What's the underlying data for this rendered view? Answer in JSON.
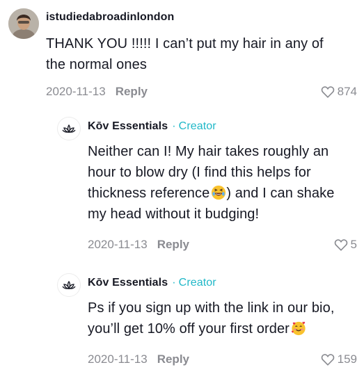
{
  "comments": [
    {
      "username": "istudiedabroadinlondon",
      "text_lines": [
        "THANK YOU !!!!! I can’t put my hair in any of",
        "the normal ones"
      ],
      "date": "2020-11-13",
      "reply_label": "Reply",
      "likes": "874"
    }
  ],
  "replies": [
    {
      "username": "Kōv Essentials",
      "separator": "·",
      "badge": "Creator",
      "text_lines": [
        "Neither can I! My hair takes roughly an",
        "hour to blow dry (I find this helps for",
        "thickness reference",
        ") and I can shake",
        "my head without it budging!"
      ],
      "emoji": "laughing-face-emoji",
      "date": "2020-11-13",
      "reply_label": "Reply",
      "likes": "5"
    },
    {
      "username": "Kōv Essentials",
      "separator": "·",
      "badge": "Creator",
      "text_lines": [
        "Ps if you sign up with the link in our bio,",
        "you’ll get 10% off your first order"
      ],
      "emoji": "smiling-face-with-hearts-emoji",
      "date": "2020-11-13",
      "reply_label": "Reply",
      "likes": "159"
    }
  ],
  "colors": {
    "creator_accent": "#20b8c8",
    "meta_gray": "#8a8b91",
    "text": "#161823"
  }
}
